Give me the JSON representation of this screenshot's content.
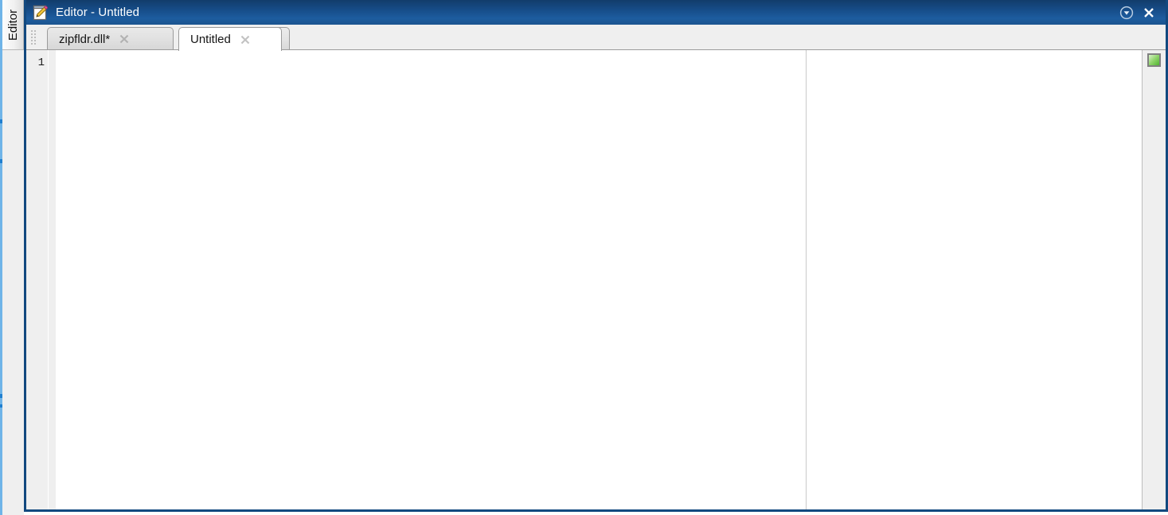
{
  "window": {
    "title": "Editor - Untitled",
    "app_icon": "editor-pencil-icon",
    "dock_label": "Editor",
    "controls": [
      {
        "name": "dock-menu-button",
        "icon": "circle-chevron-down-icon",
        "label": "▼"
      },
      {
        "name": "close-button",
        "icon": "close-x-icon",
        "label": "✕"
      }
    ],
    "accent_color": "#12497f",
    "titlebar_color": "#174f8c",
    "dock_strip_color": "#1f7fd0"
  },
  "tabs": {
    "grip": "drag-grip-handle",
    "items": [
      {
        "label": "zipfldr.dll*",
        "active": false,
        "modified": true,
        "close_icon": "close-x-icon"
      },
      {
        "label": "Untitled",
        "active": true,
        "modified": false,
        "close_icon": "close-x-icon"
      }
    ],
    "add_tab": {
      "label": "+",
      "icon": "plus-icon"
    }
  },
  "editor": {
    "line_numbers": [
      "1"
    ],
    "content": "",
    "column_rule": true,
    "analyzer": {
      "status": "ok",
      "color": "#7fd05a",
      "icon": "analyzer-status-square"
    }
  }
}
